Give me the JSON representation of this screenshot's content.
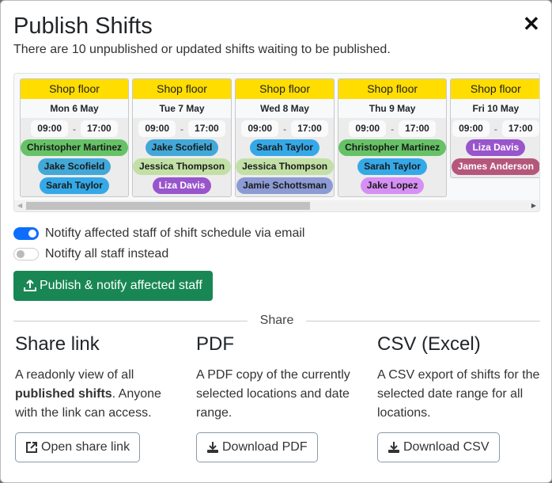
{
  "modal": {
    "title": "Publish Shifts",
    "subtitle": "There are 10 unpublished or updated shifts waiting to be published.",
    "close_icon": "close-icon"
  },
  "schedule": {
    "columns": [
      {
        "location": "Shop floor",
        "date": "Mon 6 May",
        "start": "09:00",
        "end": "17:00",
        "staff": [
          {
            "name": "Christopher Martinez",
            "color": "#66c266",
            "text": "#1a1a1a"
          },
          {
            "name": "Jake Scofield",
            "color": "#42a8d8",
            "text": "#1a1a1a"
          },
          {
            "name": "Sarah Taylor",
            "color": "#35a9e8",
            "text": "#1a1a1a"
          }
        ]
      },
      {
        "location": "Shop floor",
        "date": "Tue 7 May",
        "start": "09:00",
        "end": "17:00",
        "staff": [
          {
            "name": "Jake Scofield",
            "color": "#42a8d8",
            "text": "#1a1a1a"
          },
          {
            "name": "Jessica Thompson",
            "color": "#c2e0a6",
            "text": "#1a1a1a"
          },
          {
            "name": "Liza Davis",
            "color": "#9955cc",
            "text": "#ffffff"
          }
        ]
      },
      {
        "location": "Shop floor",
        "date": "Wed 8 May",
        "start": "09:00",
        "end": "17:00",
        "staff": [
          {
            "name": "Sarah Taylor",
            "color": "#35a9e8",
            "text": "#1a1a1a"
          },
          {
            "name": "Jessica Thompson",
            "color": "#c2e0a6",
            "text": "#1a1a1a"
          },
          {
            "name": "Jamie Schottsman",
            "color": "#8c9bd4",
            "text": "#1a1a1a"
          }
        ]
      },
      {
        "location": "Shop floor",
        "date": "Thu 9 May",
        "start": "09:00",
        "end": "17:00",
        "staff": [
          {
            "name": "Christopher Martinez",
            "color": "#66c266",
            "text": "#1a1a1a"
          },
          {
            "name": "Sarah Taylor",
            "color": "#35a9e8",
            "text": "#1a1a1a"
          },
          {
            "name": "Jake Lopez",
            "color": "#d68ff5",
            "text": "#1a1a1a"
          }
        ]
      },
      {
        "location": "Shop floor",
        "date": "Fri 10 May",
        "start": "09:00",
        "end": "17:00",
        "staff": [
          {
            "name": "Liza Davis",
            "color": "#9955cc",
            "text": "#ffffff"
          },
          {
            "name": "James Anderson",
            "color": "#b5577a",
            "text": "#ffffff"
          }
        ]
      }
    ],
    "header_color": "#ffdd00"
  },
  "options": {
    "notify_affected": {
      "label": "Notifty affected staff of shift schedule via email",
      "checked": true
    },
    "notify_all": {
      "label": "Notifty all staff instead",
      "checked": false
    }
  },
  "publish_button": {
    "label": "Publish & notify affected staff",
    "icon": "upload-icon",
    "color": "#198754"
  },
  "share": {
    "divider_label": "Share",
    "link": {
      "title": "Share link",
      "desc_before": "A readonly view of all ",
      "desc_bold": "published shifts",
      "desc_after": ". Anyone with the link can access.",
      "button": "Open share link",
      "icon": "external-link-icon"
    },
    "pdf": {
      "title": "PDF",
      "desc": "A PDF copy of the currently selected locations and date range.",
      "button": "Download PDF",
      "icon": "download-icon"
    },
    "csv": {
      "title": "CSV (Excel)",
      "desc": "A CSV export of shifts for the selected date range for all locations.",
      "button": "Download CSV",
      "icon": "download-icon"
    }
  }
}
